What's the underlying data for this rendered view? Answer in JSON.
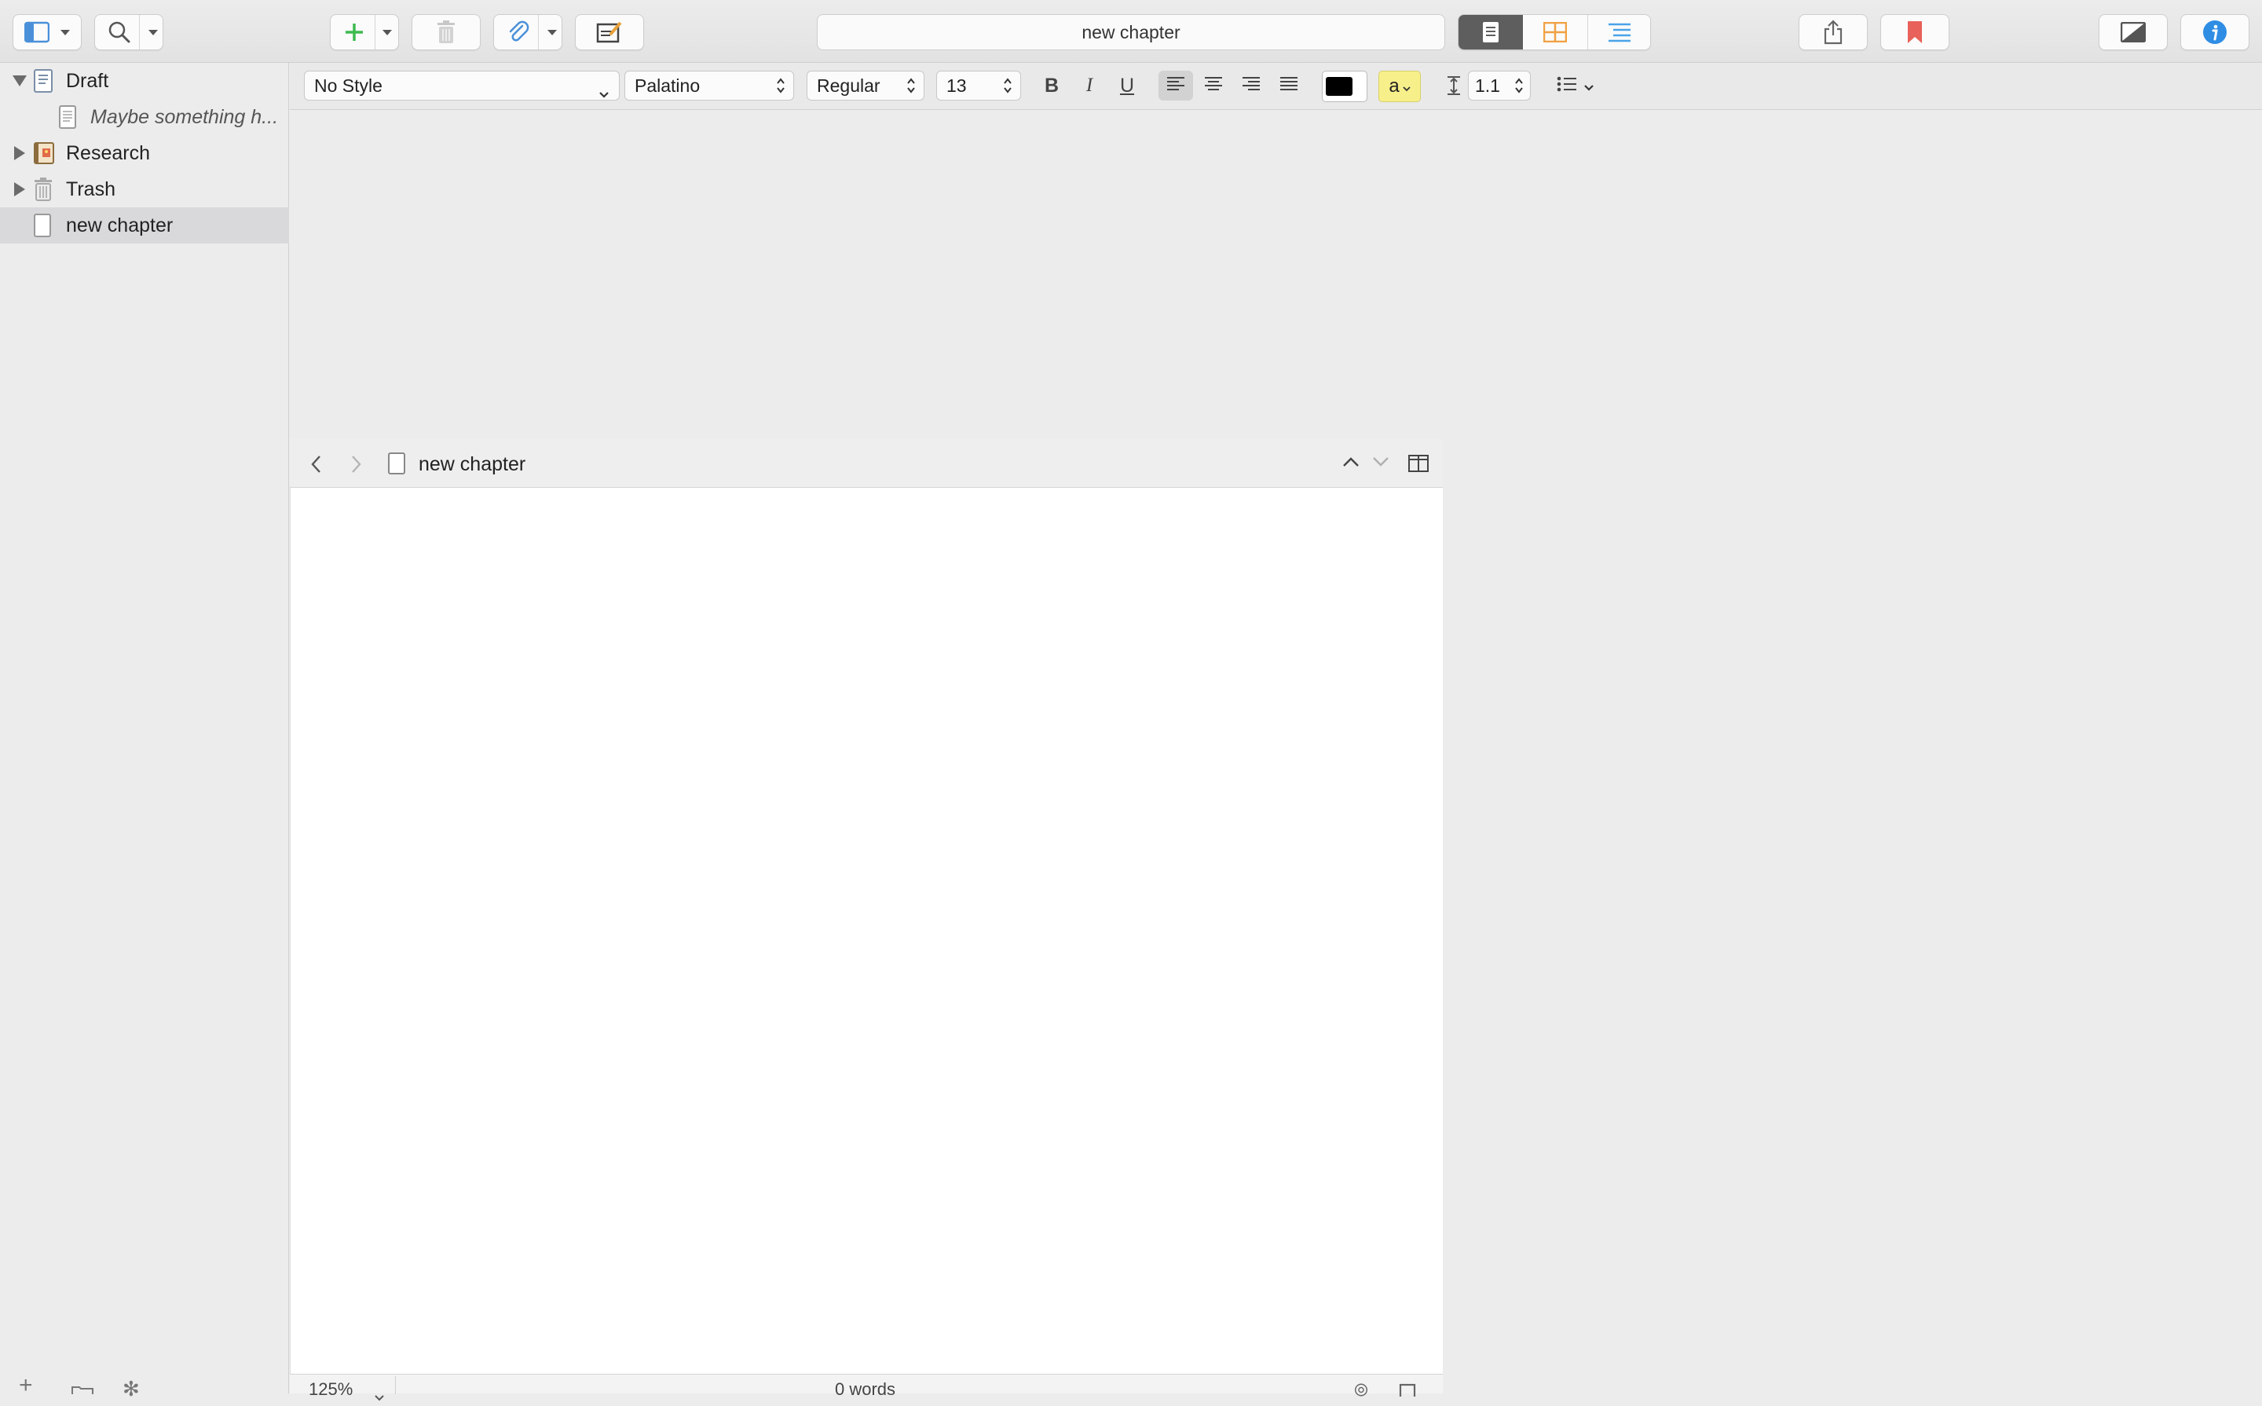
{
  "toolbar": {
    "document_title": "new chapter",
    "colors": {
      "add_green": "#3dbb4f",
      "attach_blue": "#4a90d9",
      "bookmark_red": "#e8615a",
      "info_blue": "#2f8de4",
      "corkboard_orange": "#f0a143",
      "outline_blue": "#4aa3e8",
      "selected_segment": "#5e5e5e"
    },
    "icons": [
      "binder-icon",
      "search-icon",
      "add-icon",
      "trash-icon",
      "attachment-icon",
      "compose-icon",
      "document-view-icon",
      "corkboard-icon",
      "outline-icon",
      "share-icon",
      "bookmark-icon",
      "composition-mode-icon",
      "inspector-info-icon"
    ]
  },
  "binder": {
    "items": [
      {
        "label": "Draft",
        "icon": "draft-folder-icon",
        "expanded": true
      },
      {
        "label": "Maybe something h...",
        "icon": "text-document-icon",
        "italic": true
      },
      {
        "label": "Research",
        "icon": "research-folder-icon",
        "expanded": false
      },
      {
        "label": "Trash",
        "icon": "trash-folder-icon",
        "expanded": false
      },
      {
        "label": "new chapter",
        "icon": "blank-document-icon",
        "selected": true
      }
    ]
  },
  "format_bar": {
    "style": "No Style",
    "font": "Palatino",
    "weight": "Regular",
    "size": "13",
    "bold": "B",
    "italic": "I",
    "underline": "U",
    "text_color": "#000000",
    "highlight_label": "a",
    "highlight_color": "#f7ef8a",
    "line_spacing": "1.1"
  },
  "editor": {
    "header_title": "new chapter",
    "footer_zoom": "125%",
    "footer_words": "0 words"
  }
}
